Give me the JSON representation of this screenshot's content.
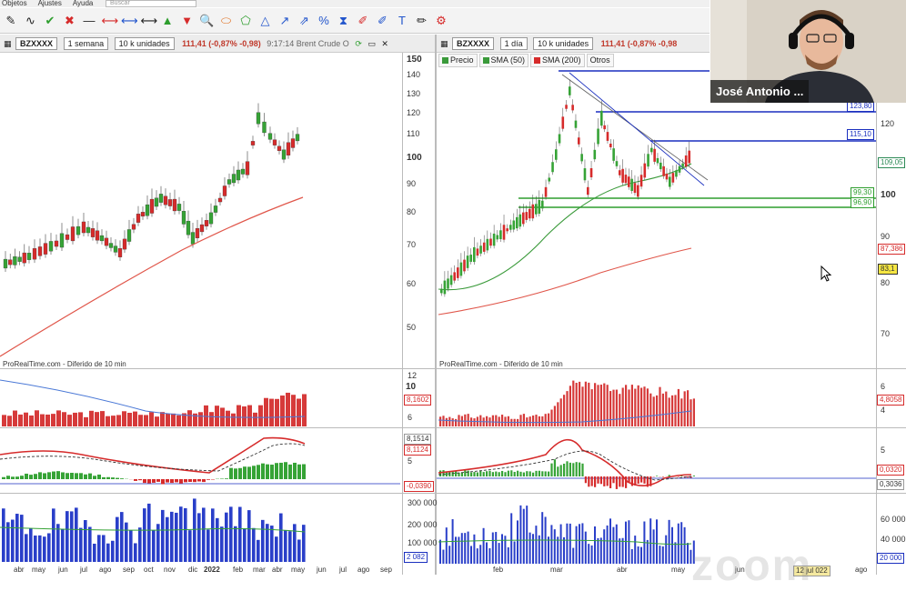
{
  "menu": {
    "items": [
      "Objetos",
      "Ajustes",
      "Ayuda"
    ],
    "search_placeholder": "Buscar"
  },
  "toolbar": {
    "tools": [
      {
        "name": "draw-tool-icon",
        "glyph": "✎"
      },
      {
        "name": "wave-tool-icon",
        "glyph": "∿"
      },
      {
        "name": "check-icon",
        "glyph": "✔",
        "color": "#2e9e2e"
      },
      {
        "name": "delete-icon",
        "glyph": "✖",
        "color": "#d62b2b"
      },
      {
        "name": "line-tool-icon",
        "glyph": "—"
      },
      {
        "name": "segment-red-icon",
        "glyph": "⟷",
        "color": "#d62b2b"
      },
      {
        "name": "segment-blue-icon",
        "glyph": "⟷",
        "color": "#2255cc"
      },
      {
        "name": "segment-gray-icon",
        "glyph": "⟷"
      },
      {
        "name": "arrow-up-icon",
        "glyph": "▲",
        "color": "#2e9e2e"
      },
      {
        "name": "arrow-down-icon",
        "glyph": "▼",
        "color": "#d62b2b"
      },
      {
        "name": "zoom-icon",
        "glyph": "🔍"
      },
      {
        "name": "ellipse-tool-icon",
        "glyph": "⬭",
        "color": "#e07020"
      },
      {
        "name": "shape-tool-icon",
        "glyph": "⬠",
        "color": "#2e9e2e"
      },
      {
        "name": "triangle-tool-icon",
        "glyph": "△",
        "color": "#2255cc"
      },
      {
        "name": "trendline-icon",
        "glyph": "↗",
        "color": "#2255cc"
      },
      {
        "name": "channel-icon",
        "glyph": "⇗",
        "color": "#2255cc"
      },
      {
        "name": "fibonacci-icon",
        "glyph": "%",
        "color": "#2255cc"
      },
      {
        "name": "cycle-icon",
        "glyph": "⧗",
        "color": "#2255cc"
      },
      {
        "name": "pencil-red-icon",
        "glyph": "✐",
        "color": "#d62b2b"
      },
      {
        "name": "pencil-blue-icon",
        "glyph": "✐",
        "color": "#2255cc"
      },
      {
        "name": "text-tool-icon",
        "glyph": "T",
        "color": "#2255cc"
      },
      {
        "name": "brush-icon",
        "glyph": "✏"
      },
      {
        "name": "settings-icon",
        "glyph": "⚙",
        "color": "#d62b2b"
      }
    ]
  },
  "left_panel": {
    "symbol": "BZXXXX",
    "period": "1 semana",
    "units": "10 k unidades",
    "quote": "111,41 (-0,87% -0,98)",
    "time": "9:17:14 Brent Crude O",
    "price_axis": [
      "150",
      "140",
      "130",
      "120",
      "110",
      "100",
      "90",
      "80",
      "70",
      "60",
      "50"
    ],
    "footnote": "ProRealTime.com - Diferido de 10 min",
    "ind1_axis": [
      "12",
      "10",
      "6"
    ],
    "ind1_tag": "8,1602",
    "ind2_axis": [
      "8,1514",
      "8,1124",
      "5"
    ],
    "ind2_tag": "-0,0390",
    "vol_axis": [
      "300 000",
      "200 000",
      "100 000"
    ],
    "vol_tag": "2 082",
    "months": [
      "abr",
      "may",
      "jun",
      "jul",
      "ago",
      "sep",
      "oct",
      "nov",
      "dic",
      "2022",
      "feb",
      "mar",
      "abr",
      "may",
      "jun",
      "jul",
      "ago",
      "sep"
    ]
  },
  "right_panel": {
    "symbol": "BZXXXX",
    "period": "1 día",
    "units": "10 k unidades",
    "quote": "111,41 (-0,87% -0,98",
    "legend": [
      {
        "label": "Precio",
        "color": "#3a9a3a"
      },
      {
        "label": "SMA (50)",
        "color": "#3a9a3a"
      },
      {
        "label": "SMA (200)",
        "color": "#d62b2b"
      },
      {
        "label": "Otros",
        "color": ""
      }
    ],
    "price_axis": [
      "120",
      "100",
      "90",
      "80",
      "70"
    ],
    "level_tags": [
      {
        "label": "123,80",
        "color": "#1a2fbf"
      },
      {
        "label": "115,10",
        "color": "#1a2fbf"
      },
      {
        "label": "109,05",
        "color": "#2e8b57"
      },
      {
        "label": "99,30",
        "color": "#2e9e2e"
      },
      {
        "label": "96,90",
        "color": "#2e9e2e"
      },
      {
        "label": "87,386",
        "color": "#d62b2b"
      },
      {
        "label": "83,1",
        "color": "#333333"
      }
    ],
    "footnote": "ProRealTime.com - Diferido de 10 min",
    "ind1_axis": [
      "6",
      "4"
    ],
    "ind1_tag": "4,8058",
    "ind2_axis": [
      "5",
      "0"
    ],
    "ind2_tags": [
      "0,0320",
      "0,3036"
    ],
    "vol_axis": [
      "60 000",
      "40 000",
      "20 000"
    ],
    "vol_tag": "20 082",
    "months": [
      "feb",
      "mar",
      "abr",
      "may",
      "jun",
      "ago"
    ],
    "bottom_tag": "12 jul 022"
  },
  "video": {
    "name": "José Antonio ..."
  },
  "watermark": "zoom"
}
